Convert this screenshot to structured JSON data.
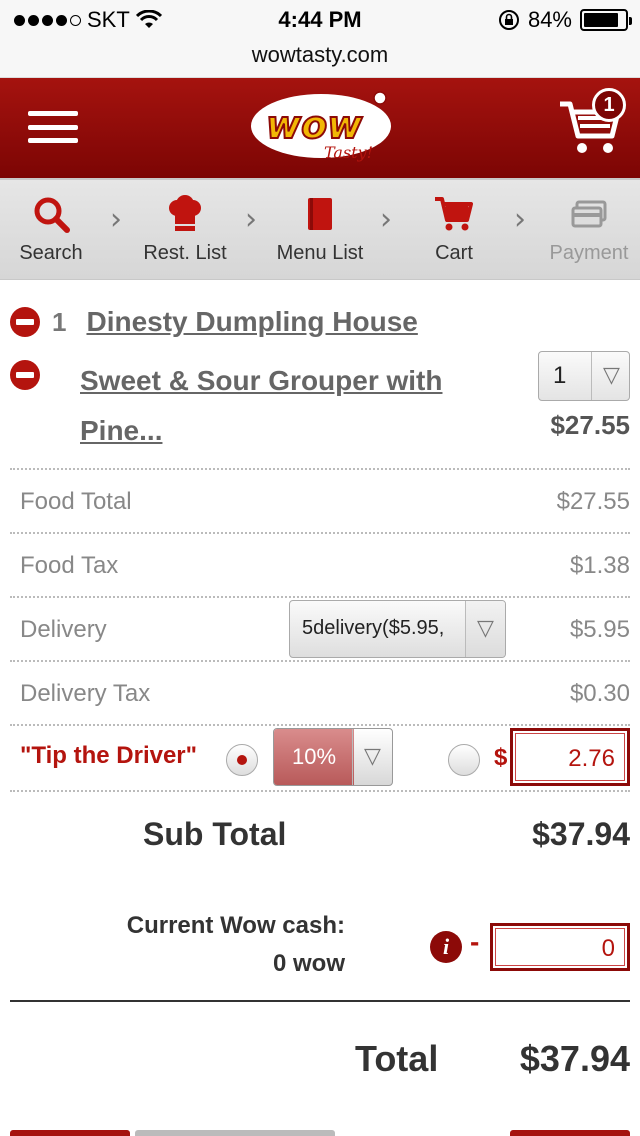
{
  "status_bar": {
    "carrier": "SKT",
    "time": "4:44 PM",
    "battery": "84%",
    "battery_level": 0.84,
    "signal_bars_filled": 4,
    "signal_bars_total": 5
  },
  "browser": {
    "url": "wowtasty.com"
  },
  "header": {
    "logo_text": "wow",
    "logo_sub": "Tasty!",
    "cart_count": "1",
    "menu_icon": "hamburger-icon",
    "cart_icon": "cart-icon"
  },
  "steps": [
    {
      "label": "Search",
      "icon": "search-icon"
    },
    {
      "label": "Rest. List",
      "icon": "chef-hat-icon"
    },
    {
      "label": "Menu List",
      "icon": "menu-book-icon"
    },
    {
      "label": "Cart",
      "icon": "cart-icon"
    },
    {
      "label": "Payment",
      "icon": "payment-card-icon",
      "disabled": true
    }
  ],
  "order": {
    "restaurant_count": "1",
    "restaurant_name": "Dinesty Dumpling House",
    "item_name": "Sweet & Sour Grouper with Pine...",
    "item_qty": "1",
    "item_price": "$27.55"
  },
  "summary": {
    "food_total_label": "Food Total",
    "food_total": "$27.55",
    "food_tax_label": "Food Tax",
    "food_tax": "$1.38",
    "delivery_label": "Delivery",
    "delivery_option": "5delivery($5.95,",
    "delivery": "$5.95",
    "delivery_tax_label": "Delivery Tax",
    "delivery_tax": "$0.30",
    "tip_label": "\"Tip the Driver\"",
    "tip_percent": "10%",
    "tip_currency": "$",
    "tip_amount": "2.76",
    "subtotal_label": "Sub Total",
    "subtotal": "$37.94",
    "wow_cash_label": "Current Wow cash:",
    "wow_cash_value": "0 wow",
    "wow_dash": "-",
    "wow_apply": "0",
    "total_label": "Total",
    "total": "$37.94"
  },
  "colors": {
    "brand_red": "#a5130f",
    "accent_red": "#b4140e"
  }
}
